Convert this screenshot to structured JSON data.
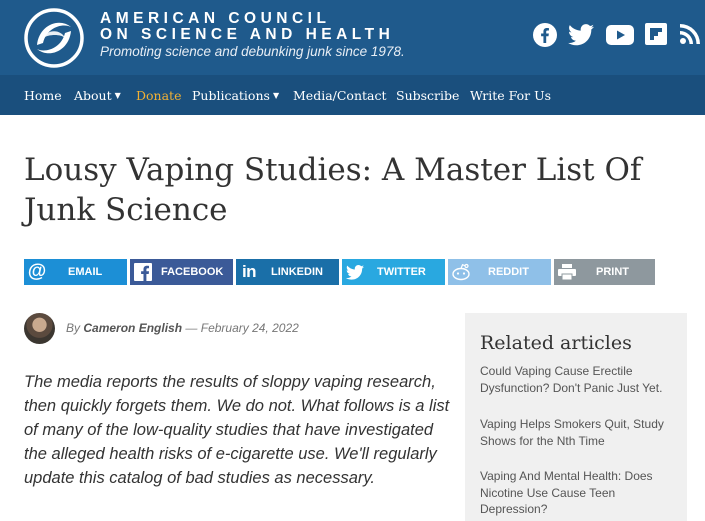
{
  "header": {
    "org_name_line1": "AMERICAN COUNCIL",
    "org_name_line2": "ON SCIENCE AND HEALTH",
    "tagline": "Promoting science and debunking junk since 1978.",
    "social_icons": [
      "facebook-icon",
      "twitter-icon",
      "youtube-icon",
      "flipboard-icon",
      "rss-icon"
    ],
    "color": "#1f5a8c"
  },
  "nav": {
    "items": [
      {
        "label": "Home"
      },
      {
        "label": "About",
        "caret": "▼"
      },
      {
        "label": "Donate"
      },
      {
        "label": "Publications",
        "caret": "▼"
      },
      {
        "label": "Media/Contact"
      },
      {
        "label": "Subscribe"
      },
      {
        "label": "Write For Us"
      }
    ],
    "donate_color": "#f2b134"
  },
  "article": {
    "title": "Lousy Vaping Studies: A Master List Of Junk Science",
    "byline_prefix": "By",
    "author": "Cameron English",
    "byline_sep": "—",
    "date": "February 24, 2022",
    "lede": "The media reports the results of sloppy vaping research, then quickly forgets them. We do not. What follows is a list of many of the low-quality studies that have investigated the alleged health risks of e-cigarette use. We'll regularly update this catalog of bad studies as necessary."
  },
  "share": [
    {
      "label": "EMAIL",
      "icon": "at-icon",
      "color": "#1c8fd6"
    },
    {
      "label": "FACEBOOK",
      "icon": "facebook-icon",
      "color": "#3b5a98"
    },
    {
      "label": "LINKEDIN",
      "icon": "linkedin-icon",
      "color": "#1a6fa8"
    },
    {
      "label": "TWITTER",
      "icon": "twitter-icon",
      "color": "#29a8e0"
    },
    {
      "label": "REDDIT",
      "icon": "reddit-icon",
      "color": "#8fc0e8"
    },
    {
      "label": "PRINT",
      "icon": "printer-icon",
      "color": "#8e989e"
    }
  ],
  "related": {
    "heading": "Related articles",
    "items": [
      {
        "label": "Could Vaping Cause Erectile Dysfunction? Don't Panic Just Yet."
      },
      {
        "label": "Vaping Helps Smokers Quit, Study Shows for the Nth Time"
      },
      {
        "label": "Vaping And Mental Health: Does Nicotine Use Cause Teen Depression?"
      }
    ]
  }
}
